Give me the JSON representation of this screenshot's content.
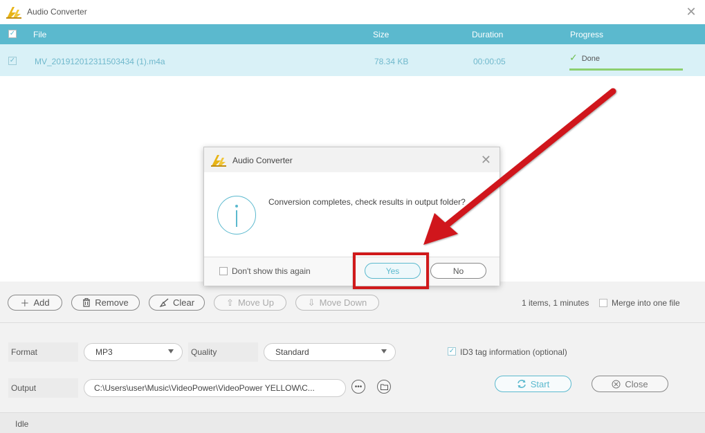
{
  "window": {
    "title": "Audio Converter",
    "close_glyph": "✕"
  },
  "table": {
    "headers": {
      "file": "File",
      "size": "Size",
      "duration": "Duration",
      "progress": "Progress"
    },
    "rows": [
      {
        "checked": true,
        "file": "MV_20191201231150343​4 (1).m4a",
        "size": "78.34 KB",
        "duration": "00:00:05",
        "status": "Done",
        "progress_fraction": 1.0
      }
    ]
  },
  "toolbar": {
    "add_label": "Add",
    "remove_label": "Remove",
    "clear_label": "Clear",
    "move_up_label": "Move Up",
    "move_down_label": "Move Down",
    "summary": "1 items, 1 minutes",
    "merge_label": "Merge into one file",
    "merge_checked": false
  },
  "settings": {
    "format_label": "Format",
    "format_value": "MP3",
    "quality_label": "Quality",
    "quality_value": "Standard",
    "id3_label": "ID3 tag information (optional)",
    "id3_checked": true,
    "output_label": "Output",
    "output_path": "C:\\Users\\user\\Music\\VideoPower\\VideoPower YELLOW\\C...",
    "start_label": "Start",
    "close_label": "Close"
  },
  "status": {
    "text": "Idle"
  },
  "dialog": {
    "title": "Audio Converter",
    "message": "Conversion completes, check results in output folder?",
    "dont_show_label": "Don't show this again",
    "dont_show_checked": false,
    "yes_label": "Yes",
    "no_label": "No"
  },
  "colors": {
    "accent": "#5bb9ce",
    "row_highlight": "#d9f1f7",
    "progress_done": "#8ccf6f",
    "annotation_red": "#d0191b"
  },
  "icons": {
    "app": "lightning-logo-icon",
    "add": "plus-icon",
    "remove": "trash-icon",
    "clear": "broom-icon",
    "move_up": "arrow-up-icon",
    "move_down": "arrow-down-icon",
    "more": "ellipsis-icon",
    "folder": "folder-icon",
    "start": "refresh-icon",
    "close": "circle-x-icon",
    "info": "info-icon",
    "done": "checkmark-icon"
  }
}
